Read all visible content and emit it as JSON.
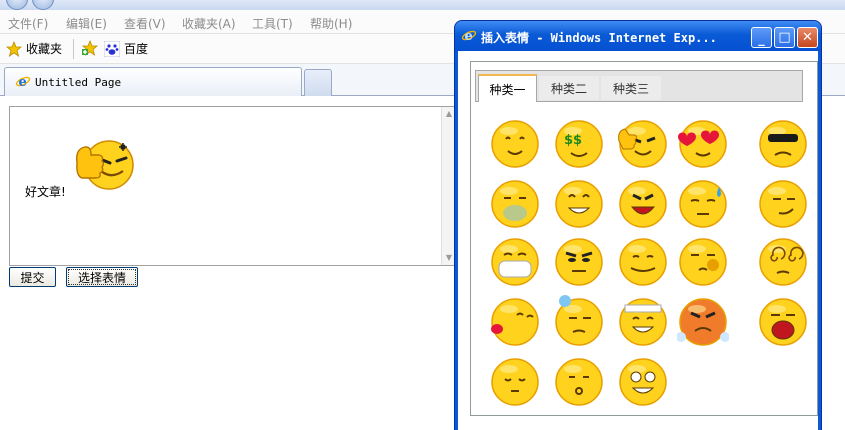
{
  "browser": {
    "menu": [
      {
        "label": "文件(F)"
      },
      {
        "label": "编辑(E)"
      },
      {
        "label": "查看(V)"
      },
      {
        "label": "收藏夹(A)"
      },
      {
        "label": "工具(T)"
      },
      {
        "label": "帮助(H)"
      }
    ],
    "favorites_label": "收藏夹",
    "baidu_label": "百度",
    "tab_title": "Untitled Page"
  },
  "page": {
    "textarea_text": "好文章!",
    "submit_label": "提交",
    "choose_label": "选择表情"
  },
  "popup": {
    "title": "插入表情 - Windows Internet Exp...",
    "tabs": [
      {
        "label": "种类一",
        "active": true
      },
      {
        "label": "种类二",
        "active": false
      },
      {
        "label": "种类三",
        "active": false
      }
    ],
    "emoticons": [
      {
        "name": "smile-emoticon"
      },
      {
        "name": "money-eyes-emoticon"
      },
      {
        "name": "thumbs-up-emoticon"
      },
      {
        "name": "heart-eyes-emoticon"
      },
      {
        "name": "angry-shades-emoticon"
      },
      {
        "name": "sick-emoticon"
      },
      {
        "name": "grin-emoticon"
      },
      {
        "name": "furious-emoticon"
      },
      {
        "name": "sweat-drop-emoticon"
      },
      {
        "name": "smirk-emoticon"
      },
      {
        "name": "mask-emoticon"
      },
      {
        "name": "glare-emoticon"
      },
      {
        "name": "awkward-smile-emoticon"
      },
      {
        "name": "confused-emoticon"
      },
      {
        "name": "dizzy-emoticon"
      },
      {
        "name": "kiss-emoticon"
      },
      {
        "name": "nervous-sweat-emoticon"
      },
      {
        "name": "bandage-laugh-emoticon"
      },
      {
        "name": "steaming-angry-emoticon"
      },
      {
        "name": "crying-emoticon"
      },
      {
        "name": "sleepy-emoticon"
      },
      {
        "name": "whistle-emoticon"
      },
      {
        "name": "silly-emoticon"
      }
    ]
  },
  "colors": {
    "face": "#ffd21e",
    "face_shade": "#e8a000",
    "popup_title": "#0a5ad6",
    "active_tab_accent": "#f2b84f"
  }
}
